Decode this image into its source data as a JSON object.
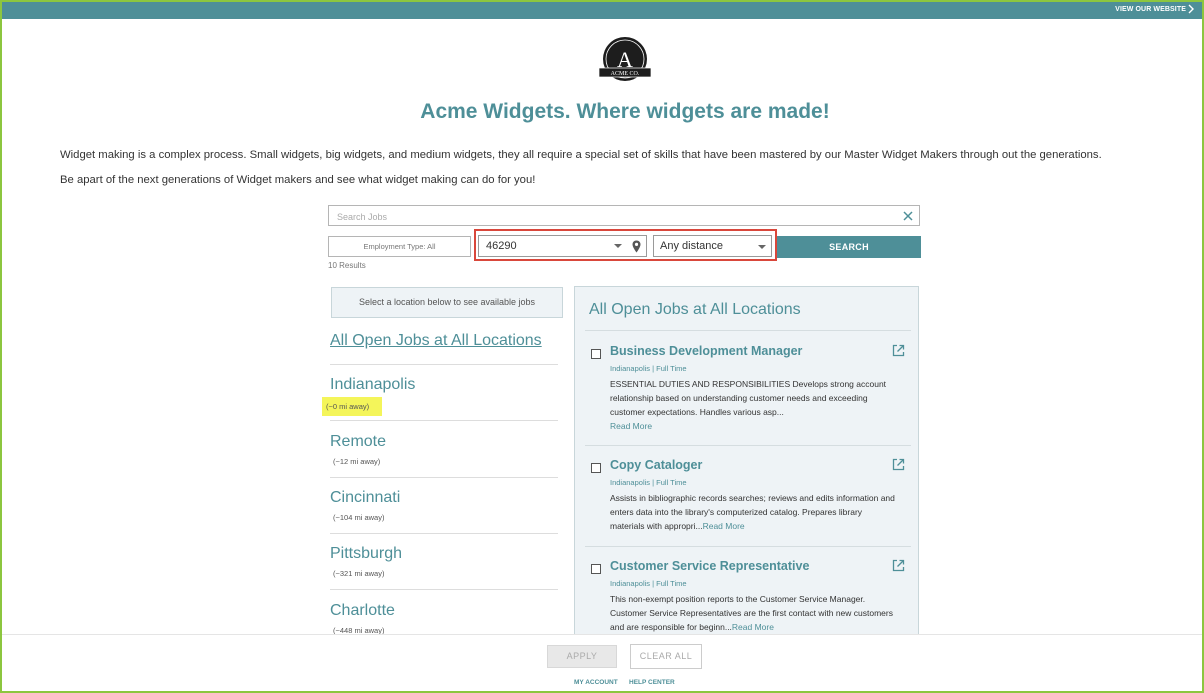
{
  "header": {
    "view_website": "VIEW OUR WEBSITE"
  },
  "logo": {
    "letter": "A",
    "text": "ACME CO."
  },
  "headline": "Acme Widgets. Where widgets are made!",
  "intro": {
    "p1": "Widget making is a complex process. Small widgets, big widgets, and medium widgets, they all require a special set of skills that have been mastered by our Master Widget Makers through out the generations.",
    "p2": "Be apart of the next generations of Widget makers and see what widget making can do for you!"
  },
  "search": {
    "placeholder": "Search Jobs",
    "employment_type": "Employment Type: All",
    "zip": "46290",
    "distance": "Any distance",
    "button": "SEARCH",
    "results": "10 Results"
  },
  "locations": {
    "hint": "Select a location below to see available jobs",
    "all_link": "All Open Jobs at All Locations",
    "items": [
      {
        "name": "Indianapolis",
        "distance": "(~0 mi away)"
      },
      {
        "name": "Remote",
        "distance": "(~12 mi away)"
      },
      {
        "name": "Cincinnati",
        "distance": "(~104 mi away)"
      },
      {
        "name": "Pittsburgh",
        "distance": "(~321 mi away)"
      },
      {
        "name": "Charlotte",
        "distance": "(~448 mi away)"
      }
    ]
  },
  "jobs": {
    "heading": "All Open Jobs at All Locations",
    "read_more": "Read More",
    "items": [
      {
        "title": "Business Development Manager",
        "meta": "Indianapolis | Full Time",
        "desc": "ESSENTIAL DUTIES AND RESPONSIBILITIES Develops strong account relationship based on understanding customer needs and exceeding customer expectations. Handles various asp..."
      },
      {
        "title": "Copy Cataloger",
        "meta": "Indianapolis | Full Time",
        "desc": "Assists in bibliographic records searches; reviews and edits information and enters data into the library's computerized catalog. Prepares library materials with appropri..."
      },
      {
        "title": "Customer Service Representative",
        "meta": "Indianapolis | Full Time",
        "desc": "This non-exempt position reports to the Customer Service Manager. Customer Service Representatives are the first contact with new customers and are responsible for beginn..."
      }
    ]
  },
  "footer": {
    "apply": "APPLY",
    "clear_all": "CLEAR ALL",
    "my_account": "MY ACCOUNT",
    "help_center": "HELP CENTER"
  },
  "colors": {
    "brand": "#4e8f98",
    "frame": "#8cc63f",
    "highlight_border": "#d9473b",
    "highlight_marker": "#f4f55a"
  }
}
